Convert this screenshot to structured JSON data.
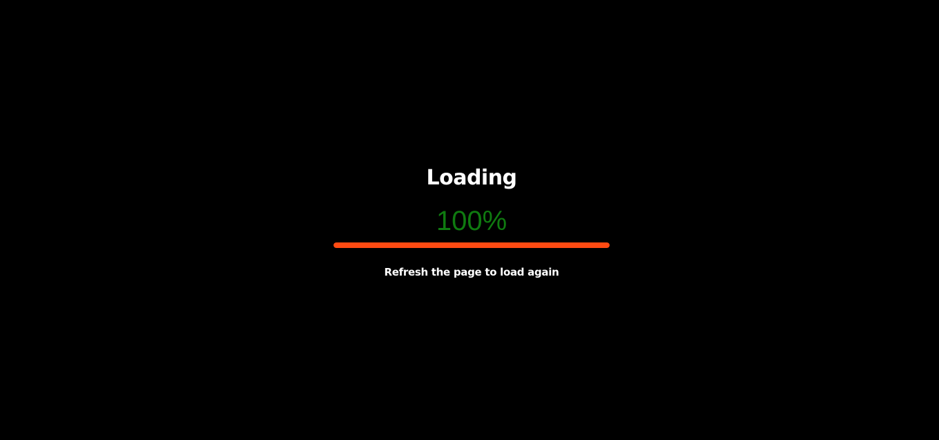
{
  "loader": {
    "title": "Loading",
    "percent_text": "100%",
    "progress_fraction": 1.0,
    "hint": "Refresh the page to load again"
  },
  "colors": {
    "background": "#000000",
    "title": "#ffffff",
    "percent": "#0f7a10",
    "progress_fill": "#ff4a12",
    "hint": "#ffffff"
  }
}
